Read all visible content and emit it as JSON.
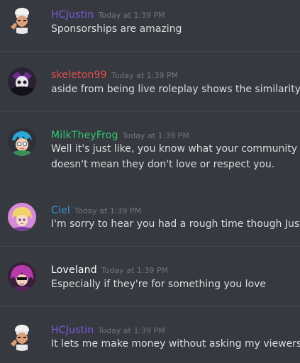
{
  "messages": [
    {
      "username": "HCJustin",
      "color": "#7c5be0",
      "timestamp": "Today at 1:39 PM",
      "lines": [
        "Sponsorships are amazing"
      ],
      "avatar": "chef-avatar"
    },
    {
      "username": "skeleton99",
      "color": "#e84f4f",
      "timestamp": "Today at 1:39 PM",
      "lines": [
        "aside from being live roleplay shows the similarity kin"
      ],
      "avatar": "skeleton-avatar"
    },
    {
      "username": "MilkTheyFrog",
      "color": "#2ecc71",
      "timestamp": "Today at 1:39 PM",
      "lines": [
        "Well it's just like, you know what your community is r",
        "doesn't mean they don't love or respect you."
      ],
      "avatar": "frog-avatar"
    },
    {
      "username": "Ciel",
      "color": "#3498db",
      "timestamp": "Today at 1:39 PM",
      "lines": [
        "I'm sorry to hear you had a rough time though Justin :"
      ],
      "avatar": "ciel-avatar"
    },
    {
      "username": "Loveland",
      "color": "#ffffff",
      "timestamp": "Today at 1:39 PM",
      "lines": [
        "Especially if they're for something you love"
      ],
      "avatar": "loveland-avatar"
    },
    {
      "username": "HCJustin",
      "color": "#7c5be0",
      "timestamp": "Today at 1:39 PM",
      "lines": [
        "It lets me make money without asking my viewers"
      ],
      "avatar": "chef-avatar"
    }
  ]
}
